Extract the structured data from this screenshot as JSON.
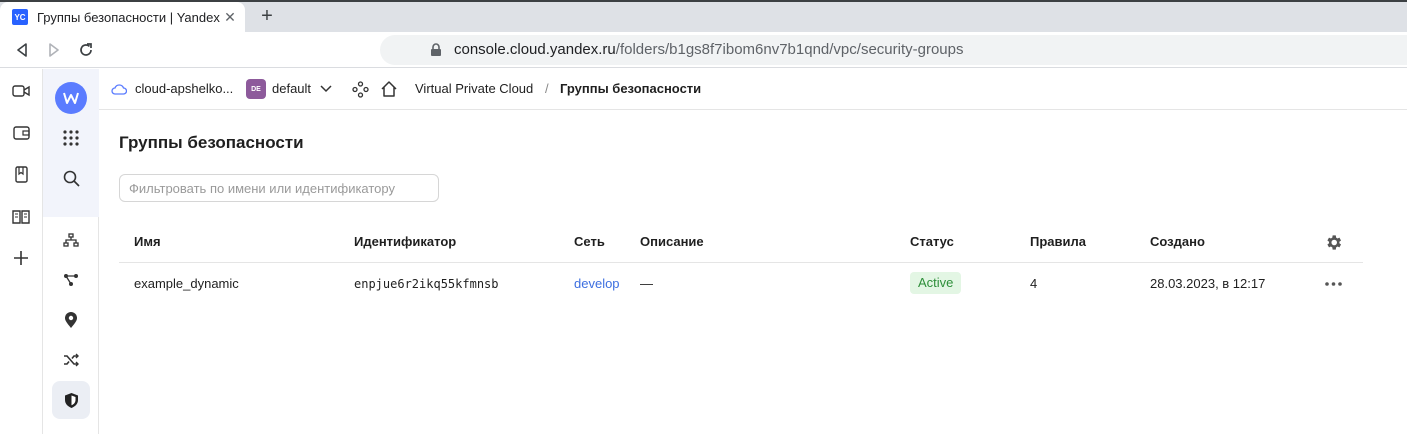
{
  "browser": {
    "tab_title": "Группы безопасности | Yandex Cloud",
    "favicon_text": "YC",
    "url_host": "console.cloud.yandex.ru",
    "url_path": "/folders/b1gs8f7ibom6nv7b1qnd/vpc/security-groups"
  },
  "header": {
    "cloud_name": "cloud-apshelko...",
    "folder_badge": "DE",
    "folder_name": "default",
    "service_link": "Virtual Private Cloud",
    "separator": "/",
    "current_page": "Группы безопасности"
  },
  "main": {
    "title": "Группы безопасности",
    "filter_placeholder": "Фильтровать по имени или идентификатору"
  },
  "table": {
    "columns": {
      "name": "Имя",
      "id": "Идентификатор",
      "network": "Сеть",
      "description": "Описание",
      "status": "Статус",
      "rules": "Правила",
      "created": "Создано"
    },
    "rows": [
      {
        "name": "example_dynamic",
        "id": "enpjue6r2ikq55kfmnsb",
        "network": "develop",
        "description": "—",
        "status": "Active",
        "rules": "4",
        "created": "28.03.2023, в 12:17"
      }
    ]
  },
  "colors": {
    "accent": "#3d6fe0",
    "status_active_bg": "#e3f6e4",
    "status_active_text": "#2e8f3a",
    "folder_badge": "#8d5a9b"
  }
}
